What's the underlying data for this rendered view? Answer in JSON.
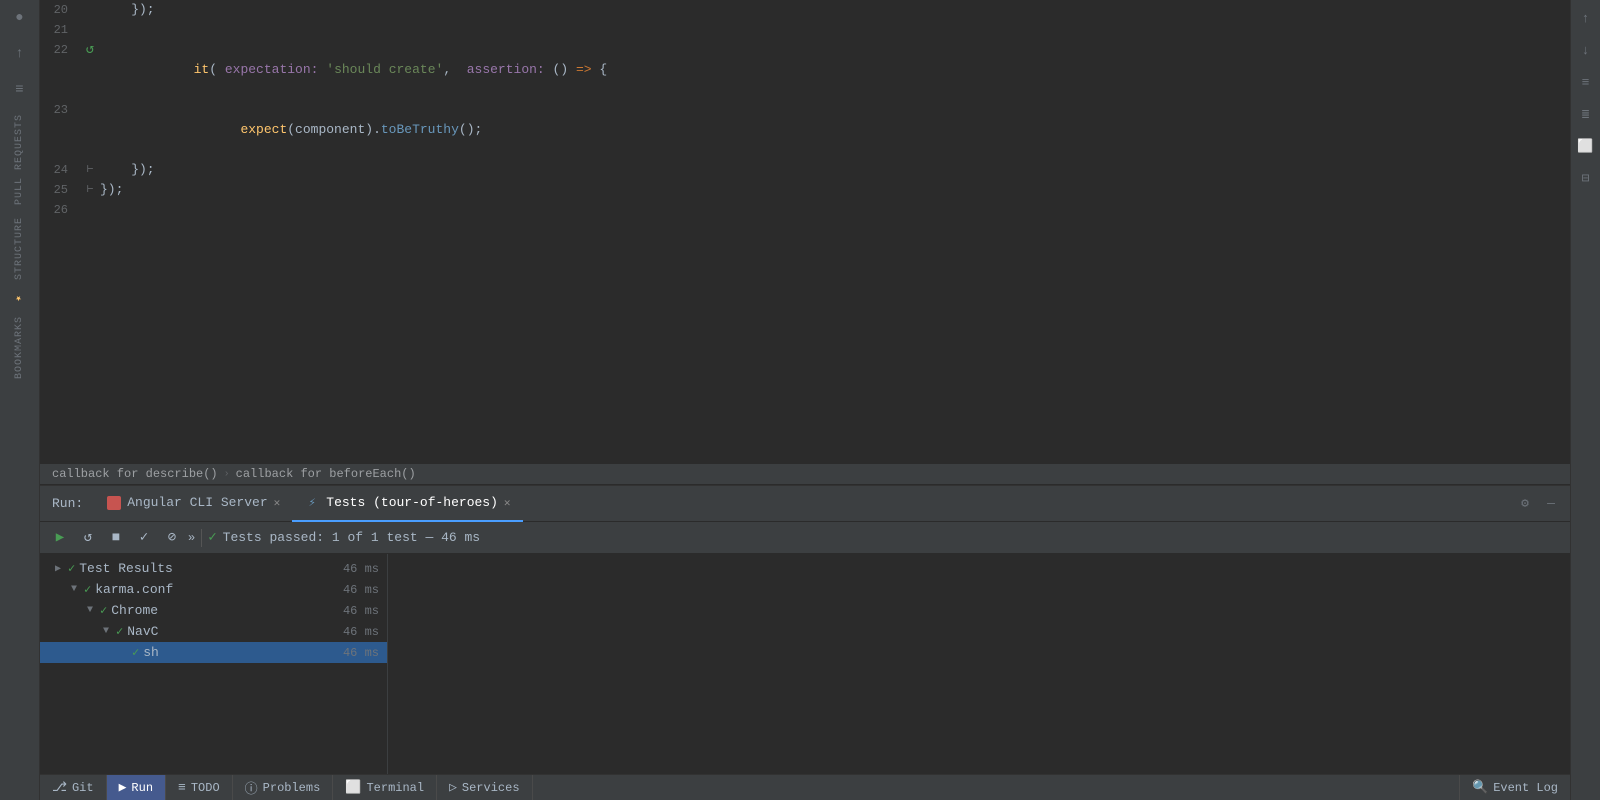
{
  "sidebar": {
    "top_icons": [
      "●",
      "↑",
      "≡"
    ],
    "labels": [
      "Pull Requests",
      "Structure",
      "Favorites",
      "Bookmarks"
    ]
  },
  "code": {
    "lines": [
      {
        "num": "20",
        "gutter": "",
        "content": "    });"
      },
      {
        "num": "21",
        "gutter": "",
        "content": ""
      },
      {
        "num": "22",
        "gutter": "▶",
        "content": "    it( expectation: 'should create',  assertion: () => {"
      },
      {
        "num": "23",
        "gutter": "",
        "content": "      expect(component).toBeTruthy();"
      },
      {
        "num": "24",
        "gutter": "⊢",
        "content": "    });"
      },
      {
        "num": "25",
        "gutter": "⊢",
        "content": "});"
      },
      {
        "num": "26",
        "gutter": "",
        "content": ""
      }
    ]
  },
  "breadcrumb": {
    "items": [
      "callback for describe()",
      "callback for beforeEach()"
    ]
  },
  "run_panel": {
    "label": "Run:",
    "tabs": [
      {
        "id": "angular-cli",
        "icon": "red-square",
        "label": "Angular CLI Server",
        "active": false
      },
      {
        "id": "tests",
        "icon": "karma",
        "label": "Tests (tour-of-heroes)",
        "active": true
      }
    ],
    "toolbar": {
      "buttons": [
        "▶",
        "↺",
        "■",
        "✓",
        "⊘"
      ],
      "more": "»",
      "status_icon": "✓",
      "status_text": "Tests passed: 1 of 1 test — 46 ms"
    },
    "test_results": {
      "root": {
        "label": "Test Results",
        "time": "46 ms",
        "expanded": true,
        "children": [
          {
            "label": "karma.conf",
            "time": "46 ms",
            "expanded": true,
            "children": [
              {
                "label": "Chrome",
                "time": "46 ms",
                "expanded": true,
                "children": [
                  {
                    "label": "NavC",
                    "time": "46 ms",
                    "expanded": true,
                    "children": [
                      {
                        "label": "sh",
                        "time": "46 ms",
                        "selected": true
                      }
                    ]
                  }
                ]
              }
            ]
          }
        ]
      }
    }
  },
  "status_bar": {
    "left_items": [
      {
        "id": "git",
        "icon": "git",
        "label": "Git"
      },
      {
        "id": "run",
        "icon": "run",
        "label": "Run",
        "active": true
      },
      {
        "id": "todo",
        "icon": "list",
        "label": "TODO"
      },
      {
        "id": "problems",
        "icon": "info",
        "label": "Problems"
      },
      {
        "id": "terminal",
        "icon": "terminal",
        "label": "Terminal"
      },
      {
        "id": "services",
        "icon": "services",
        "label": "Services"
      }
    ],
    "right_items": [
      {
        "id": "event-log",
        "icon": "search",
        "label": "Event Log"
      }
    ]
  },
  "right_sidebar": {
    "icons": [
      "↑",
      "↓",
      "≡",
      "≡↓",
      "⬜",
      "≡"
    ]
  }
}
